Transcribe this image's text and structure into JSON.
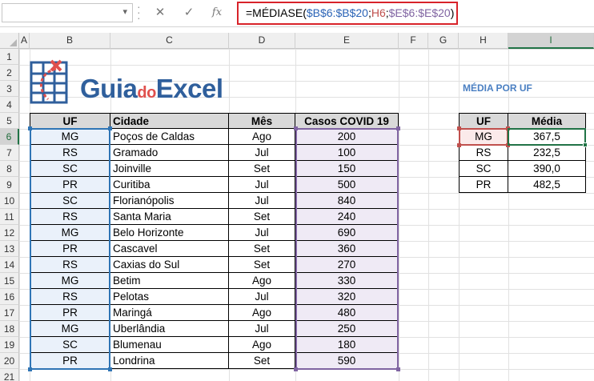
{
  "formula_bar": {
    "name_box": "",
    "cancel_icon": "✕",
    "enter_icon": "✓",
    "fx_label": "fx",
    "formula_parts": {
      "prefix": "=MÉDIASE(",
      "range_b": "$B$6:$B$20",
      "sep1": ";",
      "criteria": "H6",
      "sep2": ";",
      "range_e": "$E$6:$E$20",
      "suffix": ")"
    }
  },
  "columns": [
    "A",
    "B",
    "C",
    "D",
    "E",
    "F",
    "G",
    "H",
    "I"
  ],
  "rows": [
    "1",
    "2",
    "3",
    "4",
    "5",
    "6",
    "7",
    "8",
    "9",
    "10",
    "11",
    "12",
    "13",
    "14",
    "15",
    "16",
    "17",
    "18",
    "19",
    "20",
    "21"
  ],
  "logo": {
    "guia": "Guia",
    "do": "do",
    "excel": "Excel"
  },
  "table": {
    "headers": {
      "uf": "UF",
      "cidade": "Cidade",
      "mes": "Mês",
      "casos": "Casos COVID 19"
    },
    "rows": [
      {
        "uf": "MG",
        "cidade": "Poços de Caldas",
        "mes": "Ago",
        "casos": "200"
      },
      {
        "uf": "RS",
        "cidade": "Gramado",
        "mes": "Jul",
        "casos": "100"
      },
      {
        "uf": "SC",
        "cidade": "Joinville",
        "mes": "Set",
        "casos": "150"
      },
      {
        "uf": "PR",
        "cidade": "Curitiba",
        "mes": "Jul",
        "casos": "500"
      },
      {
        "uf": "SC",
        "cidade": "Florianópolis",
        "mes": "Jul",
        "casos": "840"
      },
      {
        "uf": "RS",
        "cidade": "Santa Maria",
        "mes": "Set",
        "casos": "240"
      },
      {
        "uf": "MG",
        "cidade": "Belo Horizonte",
        "mes": "Jul",
        "casos": "690"
      },
      {
        "uf": "PR",
        "cidade": "Cascavel",
        "mes": "Set",
        "casos": "360"
      },
      {
        "uf": "RS",
        "cidade": "Caxias do Sul",
        "mes": "Set",
        "casos": "270"
      },
      {
        "uf": "MG",
        "cidade": "Betim",
        "mes": "Ago",
        "casos": "330"
      },
      {
        "uf": "RS",
        "cidade": "Pelotas",
        "mes": "Jul",
        "casos": "320"
      },
      {
        "uf": "PR",
        "cidade": "Maringá",
        "mes": "Ago",
        "casos": "480"
      },
      {
        "uf": "MG",
        "cidade": "Uberlândia",
        "mes": "Jul",
        "casos": "250"
      },
      {
        "uf": "SC",
        "cidade": "Blumenau",
        "mes": "Ago",
        "casos": "180"
      },
      {
        "uf": "PR",
        "cidade": "Londrina",
        "mes": "Set",
        "casos": "590"
      }
    ]
  },
  "summary": {
    "title": "MÉDIA POR UF",
    "headers": {
      "uf": "UF",
      "media": "Média"
    },
    "rows": [
      {
        "uf": "MG",
        "media": "367,5"
      },
      {
        "uf": "RS",
        "media": "232,5"
      },
      {
        "uf": "SC",
        "media": "390,0"
      },
      {
        "uf": "PR",
        "media": "482,5"
      }
    ]
  },
  "colors": {
    "range_b": "#2f75b5",
    "criteria": "#c0504d",
    "range_e": "#8064a2",
    "active_cell": "#217346",
    "formula_highlight": "#d8232a"
  }
}
